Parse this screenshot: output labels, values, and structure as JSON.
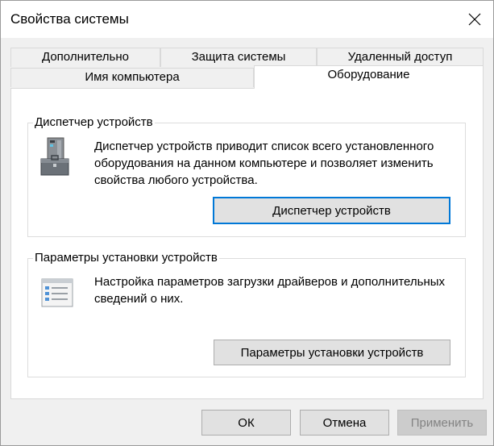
{
  "window": {
    "title": "Свойства системы"
  },
  "tabs": {
    "back_row": [
      {
        "label": "Дополнительно"
      },
      {
        "label": "Защита системы"
      },
      {
        "label": "Удаленный доступ"
      }
    ],
    "front_row": [
      {
        "label": "Имя компьютера"
      },
      {
        "label": "Оборудование"
      }
    ],
    "active": "Оборудование"
  },
  "device_manager": {
    "group_title": "Диспетчер устройств",
    "description": "Диспетчер устройств приводит список всего установленного оборудования на данном компьютере и позволяет изменить свойства любого устройства.",
    "button_label": "Диспетчер устройств",
    "icon": "device-manager-icon"
  },
  "install_settings": {
    "group_title": "Параметры установки устройств",
    "description": "Настройка параметров загрузки драйверов и дополнительных сведений о них.",
    "button_label": "Параметры установки устройств",
    "icon": "checklist-icon"
  },
  "footer": {
    "ok_label": "ОК",
    "cancel_label": "Отмена",
    "apply_label": "Применить"
  },
  "colors": {
    "focus": "#0078d7",
    "window_bg": "#f0f0f0",
    "panel_bg": "#ffffff"
  }
}
